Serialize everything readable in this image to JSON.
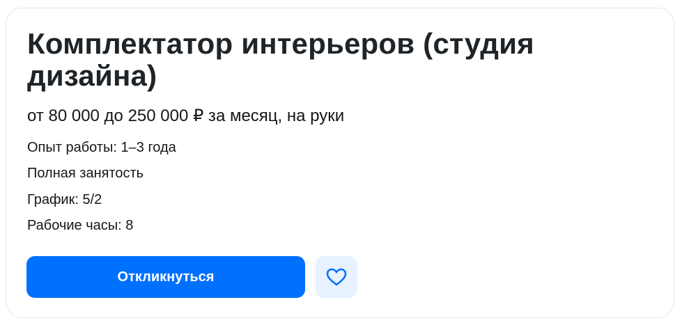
{
  "vacancy": {
    "title": "Комплектатор интерьеров (студия дизайна)",
    "salary": "от 80 000 до 250 000 ₽ за месяц, на руки",
    "details": [
      "Опыт работы: 1–3 года",
      "Полная занятость",
      "График: 5/2",
      "Рабочие часы: 8"
    ]
  },
  "actions": {
    "respond_label": "Откликнуться",
    "favorite_icon": "heart-icon"
  },
  "colors": {
    "accent": "#0070ff",
    "favorite_bg": "#e8f1ff",
    "text": "#1f2428"
  }
}
